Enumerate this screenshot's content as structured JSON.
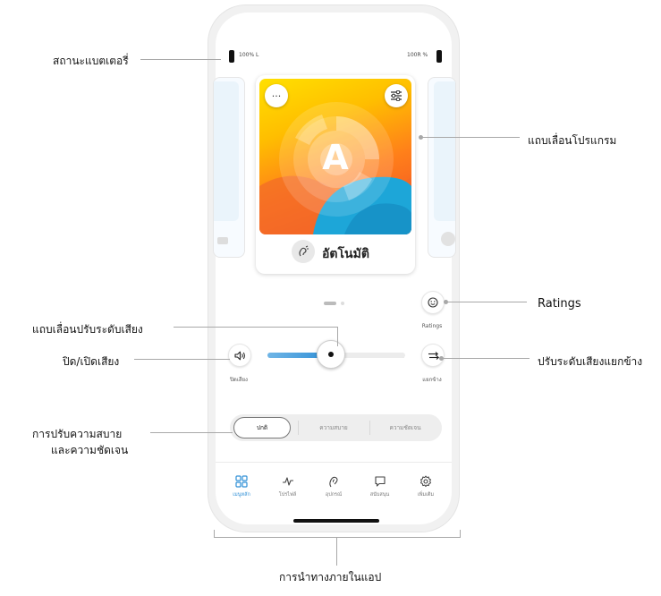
{
  "annotations": {
    "battery_status": "สถานะแบตเตอรี่",
    "program_slider": "แถบเลื่อนโปรแกรม",
    "ratings": "Ratings",
    "volume_slider": "แถบเลื่อนปรับระดับเสียง",
    "mute": "ปิด/เปิดเสียง",
    "split_volume": "ปรับระดับเสียงแยกข้าง",
    "comfort_clarity_line1": "การปรับความสบาย",
    "comfort_clarity_line2": "และความชัดเจน",
    "app_navigation": "การนำทางภายในแอป"
  },
  "status": {
    "left_battery": "100% L",
    "right_battery": "100R %"
  },
  "program": {
    "letter": "A",
    "name": "อัตโนมัติ",
    "more_label": "···"
  },
  "carousel": {
    "active_page": 1,
    "page_count": 2
  },
  "controls": {
    "ratings_label": "Ratings",
    "mute_label": "ปิดเสียง",
    "split_label": "แยกข้าง",
    "volume_level": 0.46
  },
  "comfort_tabs": [
    "ปกติ",
    "ความสบาย",
    "ความชัดเจน"
  ],
  "nav": [
    {
      "label": "เมนูหลัก",
      "icon": "grid-icon",
      "active": true
    },
    {
      "label": "โปรไฟล์",
      "icon": "pulse-icon",
      "active": false
    },
    {
      "label": "อุปกรณ์",
      "icon": "ear-icon",
      "active": false
    },
    {
      "label": "สนับสนุน",
      "icon": "chat-icon",
      "active": false
    },
    {
      "label": "เพิ่มเติม",
      "icon": "gear-icon",
      "active": false
    }
  ],
  "colors": {
    "accent": "#2f8fd6",
    "slider_fill": "#4aa0dc"
  }
}
